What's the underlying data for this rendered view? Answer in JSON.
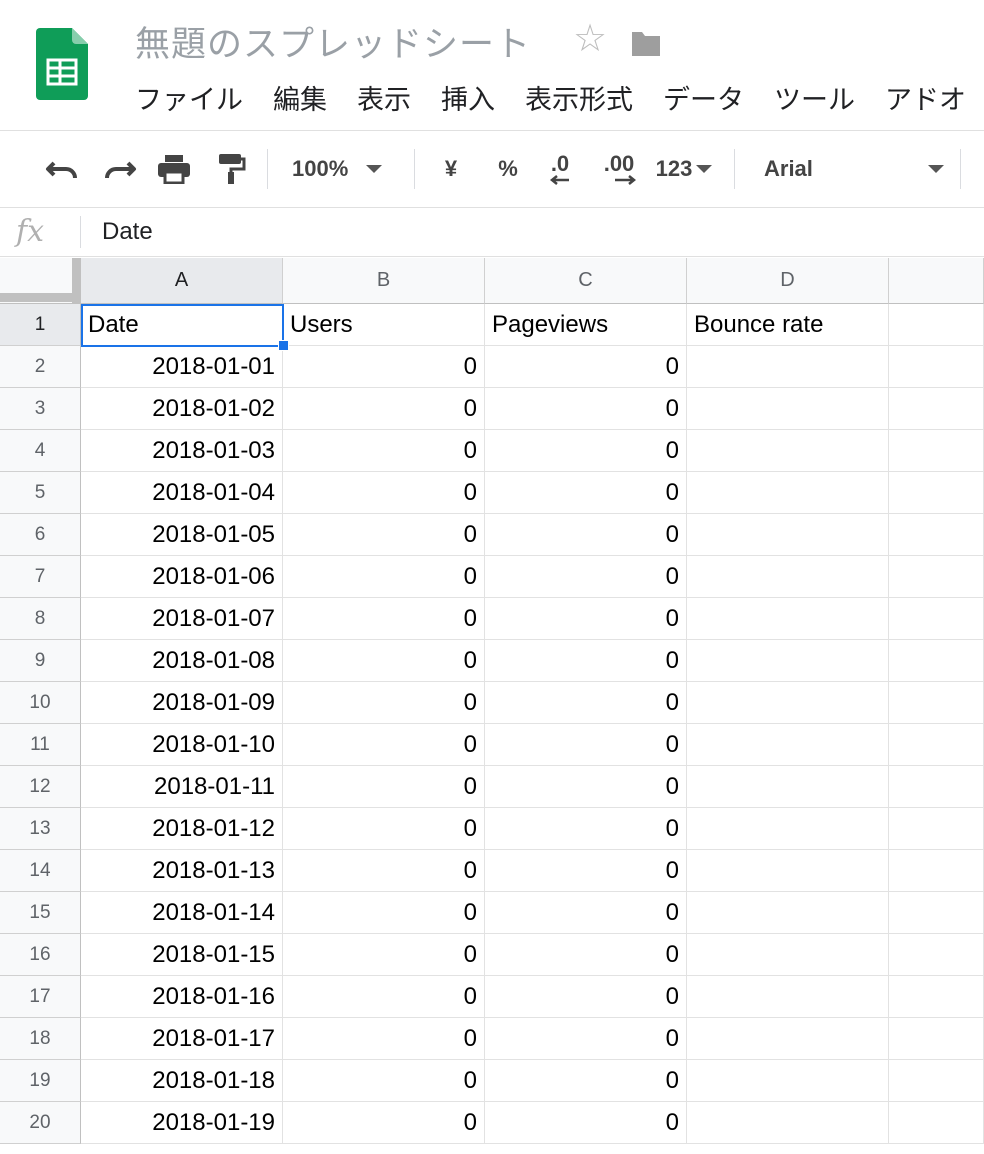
{
  "app": {
    "title": "無題のスプレッドシート",
    "menu": [
      "ファイル",
      "編集",
      "表示",
      "挿入",
      "表示形式",
      "データ",
      "ツール",
      "アドオ"
    ],
    "icons": [
      "sheets-logo",
      "star-icon",
      "folder-icon"
    ]
  },
  "toolbar": {
    "zoom": "100%",
    "currency": "¥",
    "percent": "%",
    "decrease_decimal": ".0",
    "increase_decimal": ".00",
    "more_formats": "123",
    "font": "Arial"
  },
  "formula_bar": {
    "fx": "fx",
    "value": "Date"
  },
  "grid": {
    "columns": [
      "A",
      "B",
      "C",
      "D"
    ],
    "selected_cell": "A1",
    "rows": [
      {
        "n": "1",
        "a": "Date",
        "b": "Users",
        "c": "Pageviews",
        "d": "Bounce rate"
      },
      {
        "n": "2",
        "a": "2018-01-01",
        "b": "0",
        "c": "0",
        "d": ""
      },
      {
        "n": "3",
        "a": "2018-01-02",
        "b": "0",
        "c": "0",
        "d": ""
      },
      {
        "n": "4",
        "a": "2018-01-03",
        "b": "0",
        "c": "0",
        "d": ""
      },
      {
        "n": "5",
        "a": "2018-01-04",
        "b": "0",
        "c": "0",
        "d": ""
      },
      {
        "n": "6",
        "a": "2018-01-05",
        "b": "0",
        "c": "0",
        "d": ""
      },
      {
        "n": "7",
        "a": "2018-01-06",
        "b": "0",
        "c": "0",
        "d": ""
      },
      {
        "n": "8",
        "a": "2018-01-07",
        "b": "0",
        "c": "0",
        "d": ""
      },
      {
        "n": "9",
        "a": "2018-01-08",
        "b": "0",
        "c": "0",
        "d": ""
      },
      {
        "n": "10",
        "a": "2018-01-09",
        "b": "0",
        "c": "0",
        "d": ""
      },
      {
        "n": "11",
        "a": "2018-01-10",
        "b": "0",
        "c": "0",
        "d": ""
      },
      {
        "n": "12",
        "a": "2018-01-11",
        "b": "0",
        "c": "0",
        "d": ""
      },
      {
        "n": "13",
        "a": "2018-01-12",
        "b": "0",
        "c": "0",
        "d": ""
      },
      {
        "n": "14",
        "a": "2018-01-13",
        "b": "0",
        "c": "0",
        "d": ""
      },
      {
        "n": "15",
        "a": "2018-01-14",
        "b": "0",
        "c": "0",
        "d": ""
      },
      {
        "n": "16",
        "a": "2018-01-15",
        "b": "0",
        "c": "0",
        "d": ""
      },
      {
        "n": "17",
        "a": "2018-01-16",
        "b": "0",
        "c": "0",
        "d": ""
      },
      {
        "n": "18",
        "a": "2018-01-17",
        "b": "0",
        "c": "0",
        "d": ""
      },
      {
        "n": "19",
        "a": "2018-01-18",
        "b": "0",
        "c": "0",
        "d": ""
      },
      {
        "n": "20",
        "a": "2018-01-19",
        "b": "0",
        "c": "0",
        "d": ""
      }
    ]
  },
  "colors": {
    "accent": "#1a73e8",
    "sheets_green": "#0f9d58"
  }
}
